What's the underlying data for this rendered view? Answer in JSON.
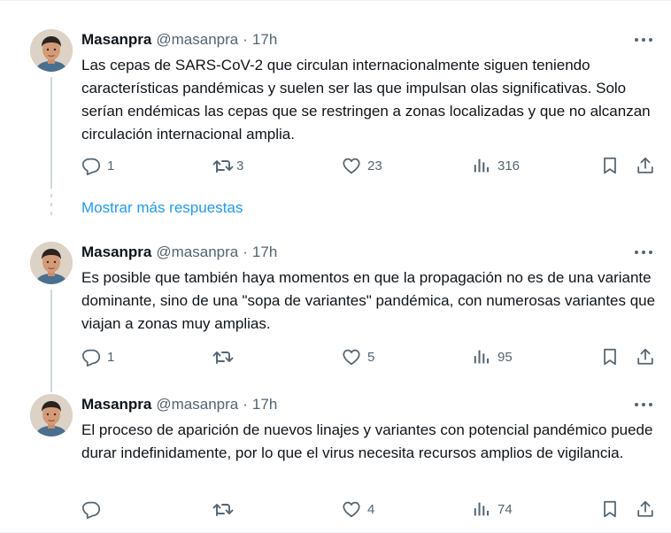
{
  "tweets": [
    {
      "name": "Masanpra",
      "handle": "@masanpra",
      "separator": "·",
      "time": "17h",
      "text": "Las cepas de SARS-CoV-2 que circulan internacionalmente siguen teniendo características pandémicas y suelen ser las que impulsan olas significativas. Solo serían endémicas las cepas que se restringen a zonas localizadas y que no alcanzan circulación internacional amplia.",
      "replies": "1",
      "reposts": "3",
      "likes": "23",
      "views": "316"
    },
    {
      "name": "Masanpra",
      "handle": "@masanpra",
      "separator": "·",
      "time": "17h",
      "text": "Es posible que también haya momentos en que la propagación no es de una variante dominante, sino de una \"sopa de variantes\" pandémica, con numerosas variantes que viajan a zonas muy amplias.",
      "replies": "1",
      "reposts": "",
      "likes": "5",
      "views": "95"
    },
    {
      "name": "Masanpra",
      "handle": "@masanpra",
      "separator": "·",
      "time": "17h",
      "text": "El proceso de aparición de nuevos linajes y variantes con potencial pandémico puede durar indefinidamente, por lo que el virus necesita recursos amplios de vigilancia.",
      "replies": "",
      "reposts": "",
      "likes": "4",
      "views": "74"
    }
  ],
  "show_more_replies": "Mostrar más respuestas",
  "icons": {
    "reply": "reply-icon",
    "repost": "repost-icon",
    "like": "like-icon",
    "views": "views-icon",
    "bookmark": "bookmark-icon",
    "share": "share-icon",
    "more": "more-icon"
  },
  "colors": {
    "text": "#0f1419",
    "secondary": "#536471",
    "link": "#1d9bf0",
    "thread_line": "#cfd9de"
  }
}
